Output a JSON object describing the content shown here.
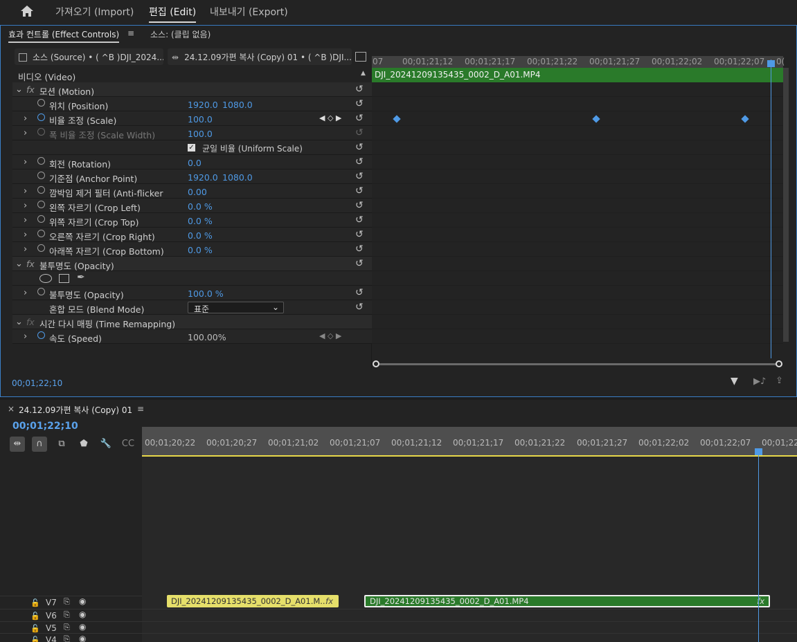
{
  "topbar": {
    "import": "가져오기 (Import)",
    "edit": "편집 (Edit)",
    "export": "내보내기 (Export)"
  },
  "panel": {
    "tab_effect": "효과 컨트롤 (Effect Controls)",
    "menu": "≡",
    "tab_source": "소스: (클립 없음)",
    "header_source": "소스 (Source) • ( ^B )DJI_2024...",
    "header_seq": "24.12.09가편 복사 (Copy) 01 • ( ^B )DJI...",
    "section_video": "비디오 (Video)",
    "clip_name": "DJI_20241209135435_0002_D_A01.MP4",
    "timecode": "00;01;22;10"
  },
  "rows": {
    "motion": "모션 (Motion)",
    "position": "위치 (Position)",
    "position_x": "1920.0",
    "position_y": "1080.0",
    "scale": "비율 조정 (Scale)",
    "scale_val": "100.0",
    "scale_width": "폭 비율 조정 (Scale Width)",
    "scale_width_val": "100.0",
    "uniform": "균일 비율 (Uniform Scale)",
    "rotation": "회전 (Rotation)",
    "rotation_val": "0.0",
    "anchor": "기준점 (Anchor Point)",
    "anchor_x": "1920.0",
    "anchor_y": "1080.0",
    "antiflicker": "깜박임 제거 필터 (Anti-flicker",
    "antiflicker_val": "0.00",
    "crop_left": "왼쪽 자르기 (Crop Left)",
    "crop_left_val": "0.0 %",
    "crop_top": "위쪽 자르기 (Crop Top)",
    "crop_top_val": "0.0 %",
    "crop_right": "오른쪽 자르기 (Crop Right)",
    "crop_right_val": "0.0 %",
    "crop_bottom": "아래쪽 자르기 (Crop Bottom)",
    "crop_bottom_val": "0.0 %",
    "opacity_sect": "불투명도 (Opacity)",
    "opacity": "불투명도 (Opacity)",
    "opacity_val": "100.0 %",
    "blend": "혼합 모드 (Blend Mode)",
    "blend_val": "표준",
    "time_remap": "시간 다시 매핑 (Time Remapping)",
    "speed": "속도 (Speed)",
    "speed_val": "100.00%"
  },
  "ec_ticks": [
    "07",
    "00;01;21;12",
    "00;01;21;17",
    "00;01;21;22",
    "00;01;21;27",
    "00;01;22;02",
    "00;01;22;07",
    "0("
  ],
  "timeline": {
    "close": "×",
    "title": "24.12.09가편 복사 (Copy) 01",
    "menu": "≡",
    "timecode": "00;01;22;10",
    "ticks": [
      "00;01;20;22",
      "00;01;20;27",
      "00;01;21;02",
      "00;01;21;07",
      "00;01;21;12",
      "00;01;21;17",
      "00;01;21;22",
      "00;01;21;27",
      "00;01;22;02",
      "00;01;22;07",
      "00;01;22;"
    ],
    "tracks": [
      "V7",
      "V6",
      "V5",
      "V4"
    ],
    "clip1": "DJI_20241209135435_0002_D_A01.M...",
    "clip2": "DJI_20241209135435_0002_D_A01.MP4",
    "fx": "fx"
  }
}
